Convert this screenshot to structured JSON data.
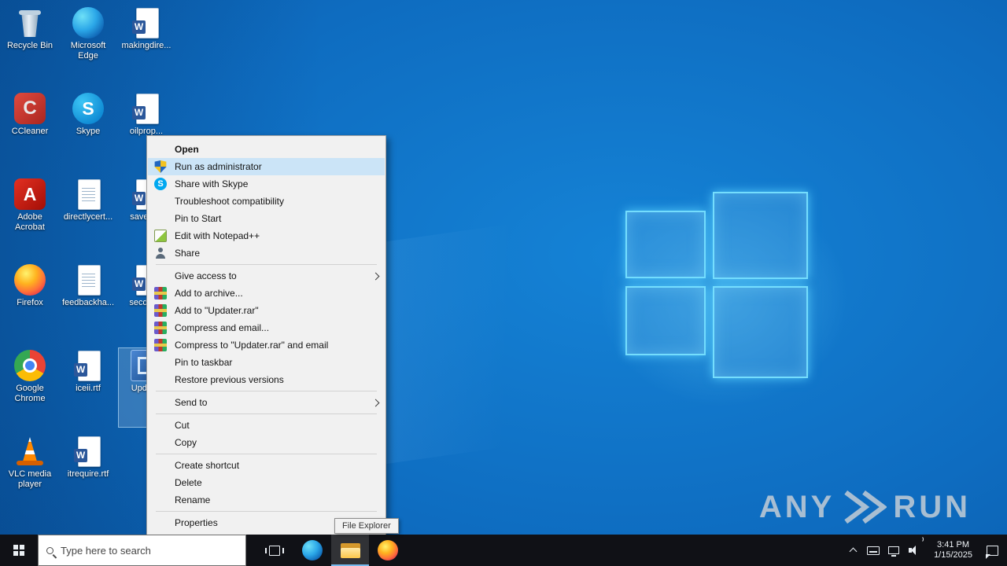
{
  "desktop": {
    "icons": [
      {
        "label": "Recycle Bin",
        "icon": "recycle-bin"
      },
      {
        "label": "CCleaner",
        "icon": "ccleaner"
      },
      {
        "label": "Adobe Acrobat",
        "icon": "acrobat"
      },
      {
        "label": "Firefox",
        "icon": "firefox"
      },
      {
        "label": "Google Chrome",
        "icon": "chrome"
      },
      {
        "label": "VLC media player",
        "icon": "vlc"
      },
      {
        "label": "Microsoft Edge",
        "icon": "edge"
      },
      {
        "label": "Skype",
        "icon": "skype"
      },
      {
        "label": "directlycert...",
        "icon": "textdoc"
      },
      {
        "label": "feedbackha...",
        "icon": "textdoc"
      },
      {
        "label": "iceii.rtf",
        "icon": "word"
      },
      {
        "label": "itrequire.rtf",
        "icon": "word"
      },
      {
        "label": "makingdire...",
        "icon": "word"
      },
      {
        "label": "oilprop...",
        "icon": "word"
      },
      {
        "label": "savegr...",
        "icon": "word"
      },
      {
        "label": "secdev...",
        "icon": "word"
      },
      {
        "label": "Updat...",
        "icon": "updater",
        "selected": "true"
      }
    ]
  },
  "context_menu": {
    "items": [
      {
        "label": "Open",
        "bold": "true"
      },
      {
        "label": "Run as administrator",
        "icon": "uac-shield",
        "highlighted": "true"
      },
      {
        "label": "Share with Skype",
        "icon": "skype"
      },
      {
        "label": "Troubleshoot compatibility"
      },
      {
        "label": "Pin to Start"
      },
      {
        "label": "Edit with Notepad++",
        "icon": "notepadpp"
      },
      {
        "label": "Share",
        "icon": "share",
        "sep_after": "true"
      },
      {
        "label": "Give access to",
        "submenu": "true"
      },
      {
        "label": "Add to archive...",
        "icon": "winrar"
      },
      {
        "label": "Add to \"Updater.rar\"",
        "icon": "winrar"
      },
      {
        "label": "Compress and email...",
        "icon": "winrar"
      },
      {
        "label": "Compress to \"Updater.rar\" and email",
        "icon": "winrar"
      },
      {
        "label": "Pin to taskbar"
      },
      {
        "label": "Restore previous versions",
        "sep_after": "true"
      },
      {
        "label": "Send to",
        "submenu": "true",
        "sep_after": "true"
      },
      {
        "label": "Cut"
      },
      {
        "label": "Copy",
        "sep_after": "true"
      },
      {
        "label": "Create shortcut"
      },
      {
        "label": "Delete"
      },
      {
        "label": "Rename",
        "sep_after": "true"
      },
      {
        "label": "Properties"
      }
    ]
  },
  "taskbar": {
    "search": {
      "placeholder": "Type here to search"
    },
    "clock": {
      "time": "3:41 PM",
      "date": "1/15/2025"
    },
    "tooltip": "File Explorer"
  },
  "watermark": {
    "any": "ANY",
    "run": "RUN"
  }
}
